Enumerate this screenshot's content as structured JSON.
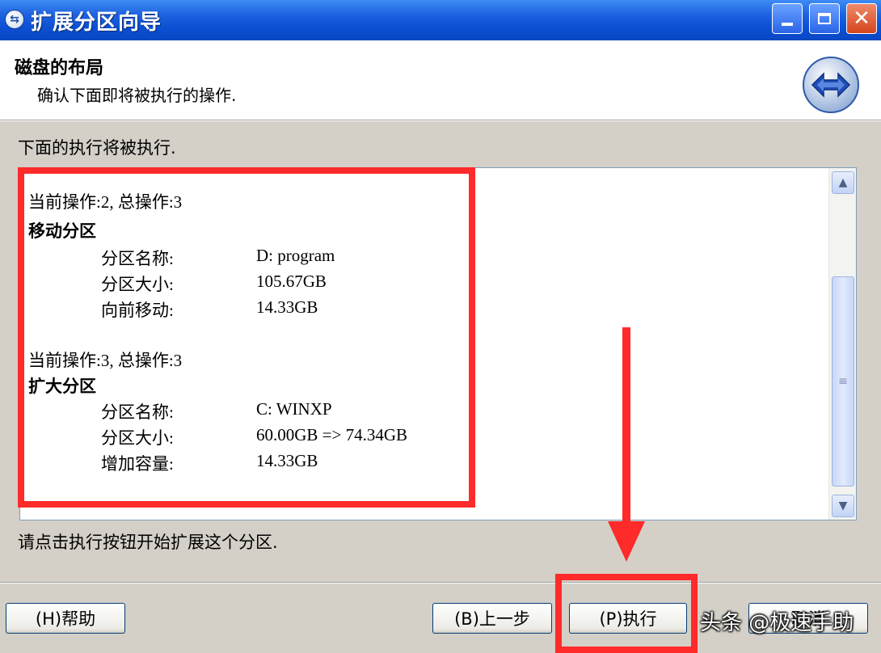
{
  "window": {
    "title": "扩展分区向导",
    "controls": {
      "minimize_icon": "minimize-icon",
      "maximize_icon": "maximize-icon",
      "close_icon": "close-icon"
    }
  },
  "header": {
    "title": "磁盘的布局",
    "subtitle": "确认下面即将被执行的操作.",
    "icon": "arrows-icon"
  },
  "lead_text": "下面的执行将被执行.",
  "operations": [
    {
      "progress": "当前操作:2, 总操作:3",
      "name": "移动分区",
      "fields": [
        {
          "label": "分区名称:",
          "value": "D: program"
        },
        {
          "label": "分区大小:",
          "value": "105.67GB"
        },
        {
          "label": "向前移动:",
          "value": "14.33GB"
        }
      ]
    },
    {
      "progress": "当前操作:3, 总操作:3",
      "name": "扩大分区",
      "fields": [
        {
          "label": "分区名称:",
          "value": "C: WINXP"
        },
        {
          "label": "分区大小:",
          "value": "60.00GB => 74.34GB"
        },
        {
          "label": "增加容量:",
          "value": "14.33GB"
        }
      ]
    }
  ],
  "hint_text": "请点击执行按钮开始扩展这个分区.",
  "buttons": {
    "help": "(H)帮助",
    "back": "(B)上一步",
    "execute": "(P)执行",
    "cancel": "取消"
  },
  "watermark": "头条 @极速手助",
  "colors": {
    "annotation": "#ff2a2a",
    "titlebar": "#0b4fd2"
  }
}
